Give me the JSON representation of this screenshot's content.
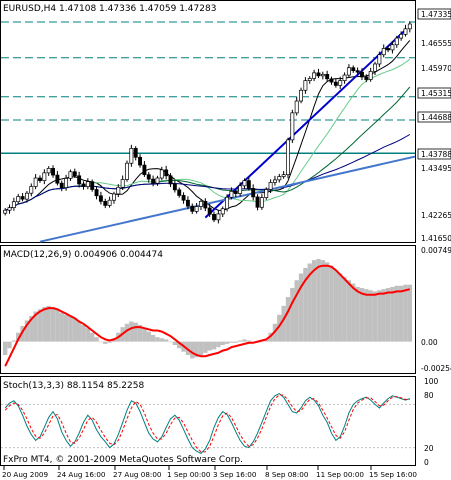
{
  "window": {
    "symbol_header": "EURUSD,H4  1.47108 1.47336 1.47059 1.47283",
    "copyright": "FxPro MT4, © 2001-2009 MetaQuotes Software Corp."
  },
  "colors": {
    "background": "#ffffff",
    "frame": "#000000",
    "bar": "#000000",
    "level_line": "#008080",
    "trend_line_main": "#0000cc",
    "trend_line_lower": "#4477cc",
    "macd_histogram": "#c0c0c0",
    "macd_signal": "#ff0000",
    "stoch_main": "#008080",
    "stoch_signal": "#ff0000",
    "ma_black": "#000000",
    "ma_green_light": "#66cc88",
    "ma_green_dark": "#006633",
    "ma_navy": "#000080"
  },
  "price_panel": {
    "axis_labels": [
      "1.47335",
      "1.46555",
      "1.45970",
      "1.45315",
      "1.44688",
      "1.43788",
      "1.43495",
      "1.42265",
      "1.41650"
    ],
    "highlighted_levels": [
      "1.47335",
      "1.46367",
      "1.45315",
      "1.44688",
      "1.43788"
    ]
  },
  "macd_panel": {
    "label": "MACD(12,26,9) 0.004906 0.004474",
    "axis_labels": [
      "0.00749",
      "0.00",
      "-0.00254"
    ]
  },
  "stoch_panel": {
    "label": "Stoch(13,3,3) 88.1154 85.2258",
    "axis_labels": [
      "100",
      "80",
      "20",
      "0"
    ]
  },
  "x_axis": {
    "labels": [
      "20 Aug 2009",
      "24 Aug 16:00",
      "27 Aug 08:00",
      "1 Sep 00:00",
      "3 Sep 16:00",
      "8 Sep 08:00",
      "11 Sep 00:00",
      "15 Sep 16:00"
    ]
  },
  "chart_data": {
    "type": "candlestick",
    "symbol": "EURUSD",
    "timeframe": "H4",
    "last_bar": {
      "open": 1.47108,
      "high": 1.47336,
      "low": 1.47059,
      "close": 1.47283
    },
    "price_range": [
      1.415,
      1.4755
    ],
    "x_labels": [
      "20 Aug 2009",
      "24 Aug 16:00",
      "27 Aug 08:00",
      "1 Sep 00:00",
      "3 Sep 16:00",
      "8 Sep 08:00",
      "11 Sep 00:00",
      "15 Sep 16:00"
    ],
    "horizontal_levels": [
      1.47335,
      1.46367,
      1.45315,
      1.44688,
      1.43788
    ],
    "close_series": [
      1.4225,
      1.4232,
      1.4248,
      1.4262,
      1.4255,
      1.4271,
      1.4289,
      1.4312,
      1.4305,
      1.4326,
      1.4338,
      1.432,
      1.4298,
      1.4286,
      1.4311,
      1.4329,
      1.4318,
      1.4296,
      1.4289,
      1.4302,
      1.4281,
      1.4264,
      1.4249,
      1.4238,
      1.4252,
      1.4269,
      1.4287,
      1.4308,
      1.4352,
      1.4392,
      1.4368,
      1.4347,
      1.4321,
      1.4309,
      1.4298,
      1.4312,
      1.4334,
      1.4318,
      1.4296,
      1.428,
      1.4265,
      1.4252,
      1.4236,
      1.4222,
      1.4235,
      1.4249,
      1.4231,
      1.4214,
      1.4199,
      1.4215,
      1.4229,
      1.426,
      1.4276,
      1.427,
      1.4291,
      1.4305,
      1.4284,
      1.4261,
      1.4233,
      1.4259,
      1.4281,
      1.43,
      1.4307,
      1.4316,
      1.4321,
      1.4415,
      1.4488,
      1.452,
      1.4549,
      1.4575,
      1.4581,
      1.4596,
      1.4588,
      1.4592,
      1.458,
      1.4571,
      1.4562,
      1.4575,
      1.459,
      1.461,
      1.4602,
      1.4598,
      1.4585,
      1.4578,
      1.46,
      1.462,
      1.4645,
      1.4662,
      1.4658,
      1.4672,
      1.469,
      1.47,
      1.4715,
      1.4728
    ],
    "macd_histogram_range": [
      -0.00254,
      0.00749
    ],
    "macd_last": {
      "main": 0.004906,
      "signal": 0.004474
    },
    "macd_histogram": [
      -0.0012,
      -0.0006,
      0.0001,
      0.0008,
      0.0014,
      0.0019,
      0.0023,
      0.0027,
      0.0029,
      0.0031,
      0.0032,
      0.0031,
      0.0029,
      0.0026,
      0.0024,
      0.0023,
      0.0021,
      0.0018,
      0.0015,
      0.0012,
      0.0008,
      0.0004,
      0.0,
      -0.0002,
      -0.0001,
      0.0003,
      0.0008,
      0.0013,
      0.0016,
      0.0018,
      0.0017,
      0.0015,
      0.0012,
      0.0009,
      0.0006,
      0.0004,
      0.0003,
      0.0002,
      0.0,
      -0.0003,
      -0.0006,
      -0.0009,
      -0.0012,
      -0.0015,
      -0.0014,
      -0.0012,
      -0.001,
      -0.0008,
      -0.0007,
      -0.0005,
      -0.0003,
      -0.0002,
      -0.0001,
      -0.0001,
      0.0001,
      0.0002,
      0.0001,
      0.0,
      -0.0001,
      0.0,
      0.0002,
      0.0008,
      0.0016,
      0.0024,
      0.0032,
      0.004,
      0.0048,
      0.0055,
      0.0061,
      0.0066,
      0.007,
      0.0073,
      0.0074,
      0.0073,
      0.0071,
      0.0068,
      0.0064,
      0.0061,
      0.0058,
      0.0055,
      0.0052,
      0.0049,
      0.0048,
      0.0047,
      0.0046,
      0.0045,
      0.0046,
      0.0047,
      0.0048,
      0.0049,
      0.005,
      0.005,
      0.0051,
      0.0051
    ],
    "macd_signal": [
      -0.0022,
      -0.0014,
      -0.0006,
      0.0002,
      0.0009,
      0.0015,
      0.002,
      0.0024,
      0.0027,
      0.0029,
      0.003,
      0.003,
      0.0029,
      0.0027,
      0.0025,
      0.0023,
      0.0021,
      0.0018,
      0.0016,
      0.0013,
      0.001,
      0.0007,
      0.0004,
      0.0002,
      0.0001,
      0.0002,
      0.0004,
      0.0007,
      0.001,
      0.0012,
      0.0013,
      0.0013,
      0.0012,
      0.0011,
      0.001,
      0.001,
      0.0009,
      0.0007,
      0.0005,
      0.0002,
      -0.0001,
      -0.0004,
      -0.0007,
      -0.001,
      -0.0012,
      -0.0013,
      -0.0013,
      -0.0012,
      -0.0011,
      -0.001,
      -0.0008,
      -0.0007,
      -0.0005,
      -0.0004,
      -0.0003,
      -0.0002,
      -0.0001,
      -0.0001,
      0.0,
      0.0001,
      0.0002,
      0.0005,
      0.0009,
      0.0014,
      0.002,
      0.0027,
      0.0035,
      0.0042,
      0.0049,
      0.0055,
      0.006,
      0.0064,
      0.0067,
      0.0068,
      0.0068,
      0.0067,
      0.0064,
      0.006,
      0.0056,
      0.0052,
      0.0048,
      0.0045,
      0.0043,
      0.0042,
      0.0042,
      0.0042,
      0.0043,
      0.0043,
      0.0044,
      0.0044,
      0.0045,
      0.0045,
      0.0046,
      0.0047
    ],
    "stoch_main": [
      75,
      82,
      85,
      78,
      65,
      50,
      38,
      30,
      35,
      48,
      62,
      70,
      60,
      42,
      30,
      22,
      28,
      40,
      55,
      65,
      58,
      45,
      35,
      28,
      20,
      25,
      38,
      55,
      72,
      85,
      82,
      70,
      55,
      40,
      32,
      28,
      35,
      48,
      60,
      65,
      58,
      45,
      32,
      20,
      15,
      12,
      18,
      30,
      48,
      62,
      70,
      66,
      55,
      42,
      30,
      22,
      20,
      28,
      40,
      55,
      70,
      85,
      92,
      95,
      90,
      80,
      70,
      68,
      75,
      85,
      90,
      86,
      78,
      65,
      55,
      40,
      30,
      35,
      50,
      68,
      80,
      85,
      88,
      90,
      86,
      80,
      75,
      82,
      88,
      92,
      90,
      88,
      86,
      88
    ],
    "stoch_signal": [
      72,
      78,
      82,
      80,
      72,
      60,
      46,
      36,
      33,
      40,
      52,
      64,
      66,
      55,
      40,
      28,
      26,
      33,
      45,
      58,
      62,
      55,
      44,
      34,
      26,
      24,
      30,
      44,
      60,
      75,
      84,
      80,
      68,
      52,
      40,
      32,
      32,
      40,
      52,
      61,
      62,
      54,
      42,
      30,
      20,
      14,
      14,
      22,
      36,
      52,
      64,
      68,
      62,
      50,
      38,
      28,
      22,
      24,
      33,
      46,
      62,
      77,
      88,
      93,
      93,
      86,
      77,
      70,
      71,
      80,
      87,
      88,
      82,
      72,
      61,
      49,
      37,
      33,
      42,
      58,
      73,
      82,
      86,
      89,
      89,
      84,
      78,
      79,
      85,
      90,
      91,
      89,
      87,
      87
    ]
  }
}
